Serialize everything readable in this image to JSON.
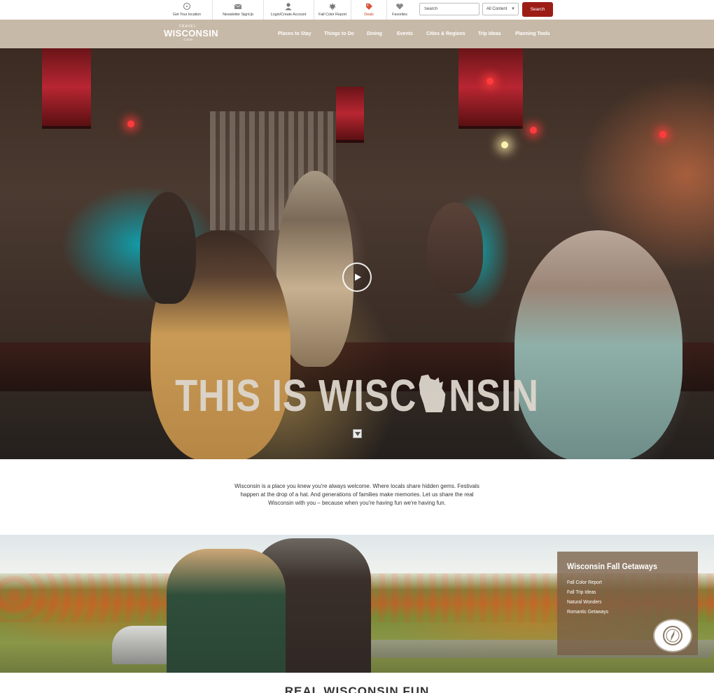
{
  "utility": {
    "items": [
      {
        "label": "Get Your location",
        "icon": "location-target-icon"
      },
      {
        "label": "Newsletter SignUp",
        "icon": "envelope-icon"
      },
      {
        "label": "Login/Create Account",
        "icon": "user-icon"
      },
      {
        "label": "Fall Color Report",
        "icon": "maple-leaf-icon"
      },
      {
        "label": "Deals",
        "icon": "tag-icon"
      },
      {
        "label": "Favorites",
        "icon": "heart-icon"
      }
    ],
    "search_placeholder": "Search",
    "content_filter": "All Content",
    "search_button": "Search",
    "accent_color": "#9c1d16"
  },
  "logo": {
    "top": "TRAVEL",
    "main": "WISCONSIN",
    "bottom": ".COM"
  },
  "nav": {
    "items": [
      "Places to Stay",
      "Things to Do",
      "Dining",
      "Events",
      "Cities & Regions",
      "Trip Ideas",
      "Planning Tools"
    ],
    "background": "#c7b9a8"
  },
  "hero": {
    "headline_left": "THIS IS WISC",
    "headline_right": "NSIN"
  },
  "intro": {
    "text": "Wisconsin is a place you knew you're always welcome. Where locals share hidden gems. Festivals happen at the drop of a hat. And generations of families make memories. Let us share the real Wisconsin with you – because when you're having fun we're having fun."
  },
  "fall": {
    "title": "Wisconsin Fall Getaways",
    "links": [
      "Fall Color Report",
      "Fall Trip Ideas",
      "Natural Wonders",
      "Romantic Getaways"
    ]
  },
  "bottom_heading": "REAL WISCONSIN FUN"
}
